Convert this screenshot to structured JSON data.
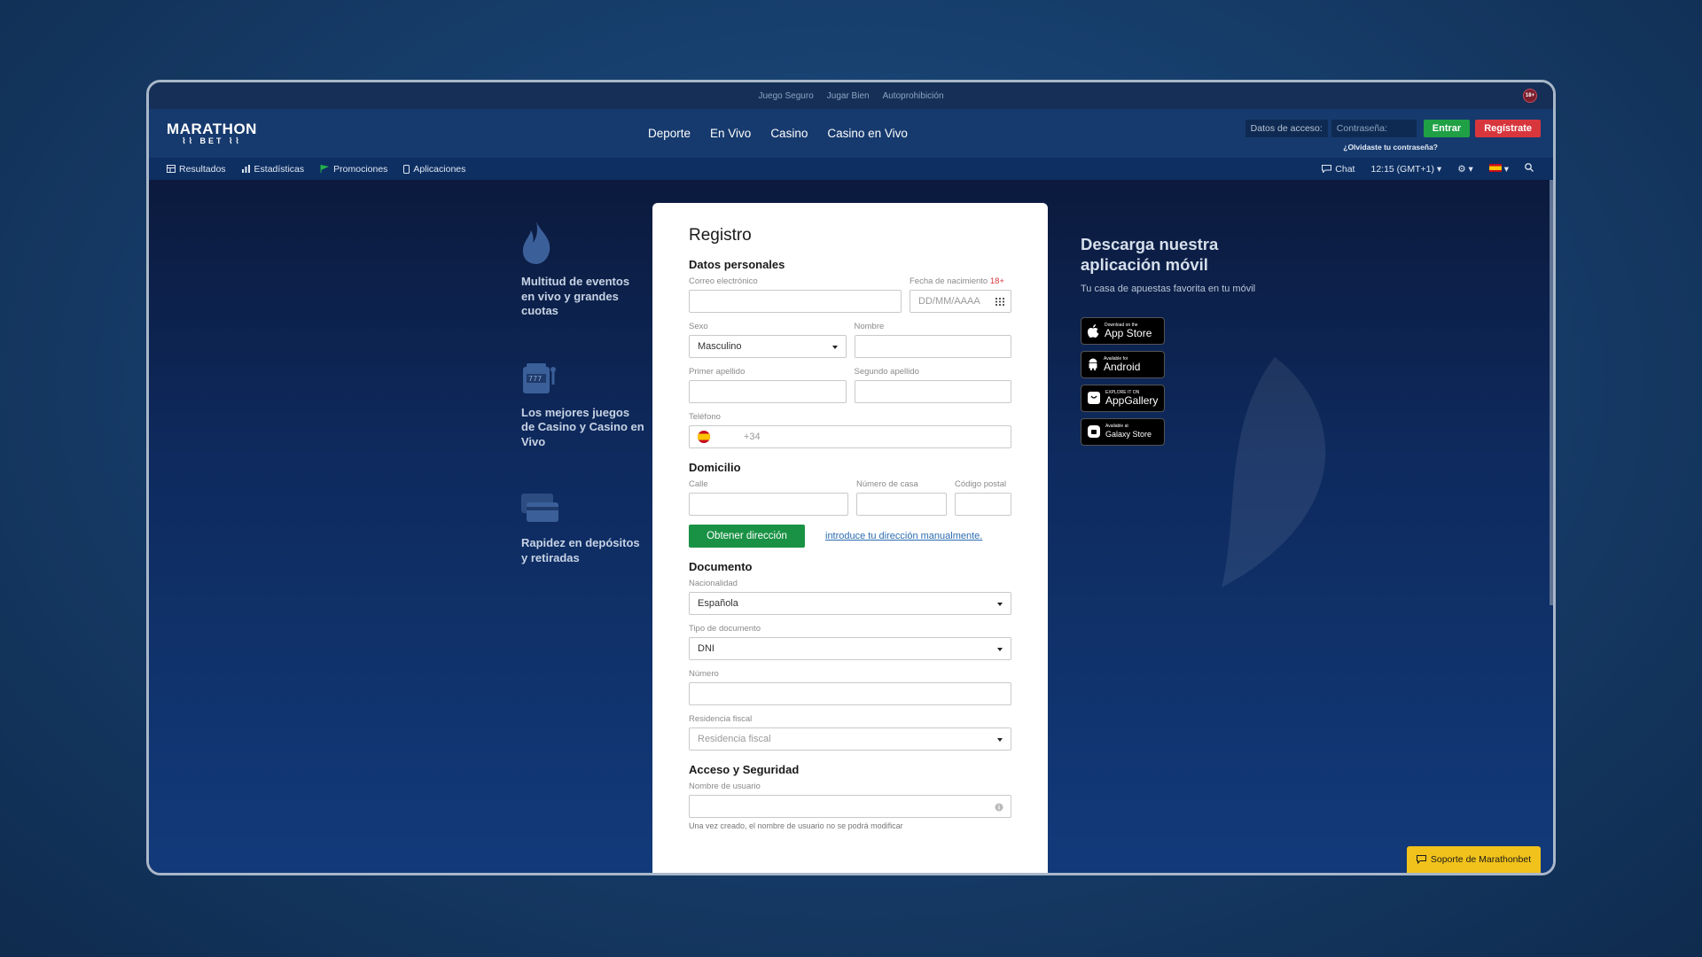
{
  "top_links": [
    "Juego Seguro",
    "Jugar Bien",
    "Autoprohibición"
  ],
  "age_badge": "18+",
  "brand": {
    "line1": "MARATHON",
    "line2": "BET"
  },
  "main_nav": [
    "Deporte",
    "En Vivo",
    "Casino",
    "Casino en Vivo"
  ],
  "login": {
    "label": "Datos de acceso:",
    "password_placeholder": "Contraseña:",
    "enter": "Entrar",
    "register": "Regístrate",
    "forgot": "¿Olvidaste tu contraseña?"
  },
  "sub_nav": {
    "results": "Resultados",
    "stats": "Estadísticas",
    "promos": "Promociones",
    "apps": "Aplicaciones",
    "chat": "Chat",
    "time": "12:15 (GMT+1)"
  },
  "features": [
    "Multitud de eventos en vivo y grandes cuotas",
    "Los mejores juegos de Casino y Casino en Vivo",
    "Rapidez en depósitos y retiradas"
  ],
  "form": {
    "title": "Registro",
    "personal": {
      "heading": "Datos personales",
      "email_label": "Correo electrónico",
      "dob_label": "Fecha de nacimiento",
      "dob_req": "18+",
      "dob_placeholder": "DD/MM/AAAA",
      "sex_label": "Sexo",
      "sex_value": "Masculino",
      "name_label": "Nombre",
      "surname1_label": "Primer apellido",
      "surname2_label": "Segundo apellido",
      "phone_label": "Teléfono",
      "phone_prefix": "+34"
    },
    "address": {
      "heading": "Domicilio",
      "street_label": "Calle",
      "number_label": "Número de casa",
      "zip_label": "Código postal",
      "get_button": "Obtener dirección",
      "manual_link": "introduce tu dirección manualmente."
    },
    "document": {
      "heading": "Documento",
      "nationality_label": "Nacionalidad",
      "nationality_value": "Española",
      "doctype_label": "Tipo de documento",
      "doctype_value": "DNI",
      "number_label": "Número",
      "tax_label": "Residencia fiscal",
      "tax_placeholder": "Residencia fiscal"
    },
    "security": {
      "heading": "Acceso y Seguridad",
      "username_label": "Nombre de usuario",
      "username_note": "Una vez creado, el nombre de usuario no se podrá modificar"
    }
  },
  "app_promo": {
    "title": "Descarga nuestra aplicación móvil",
    "subtitle": "Tu casa de apuestas favorita en tu móvil",
    "stores": [
      {
        "small": "Download on the",
        "big": "App Store"
      },
      {
        "small": "Available for",
        "big": "Android"
      },
      {
        "small": "EXPLORE IT ON",
        "big": "AppGallery"
      },
      {
        "small": "Available at",
        "big": "Galaxy Store"
      }
    ]
  },
  "support": "Soporte de Marathonbet"
}
